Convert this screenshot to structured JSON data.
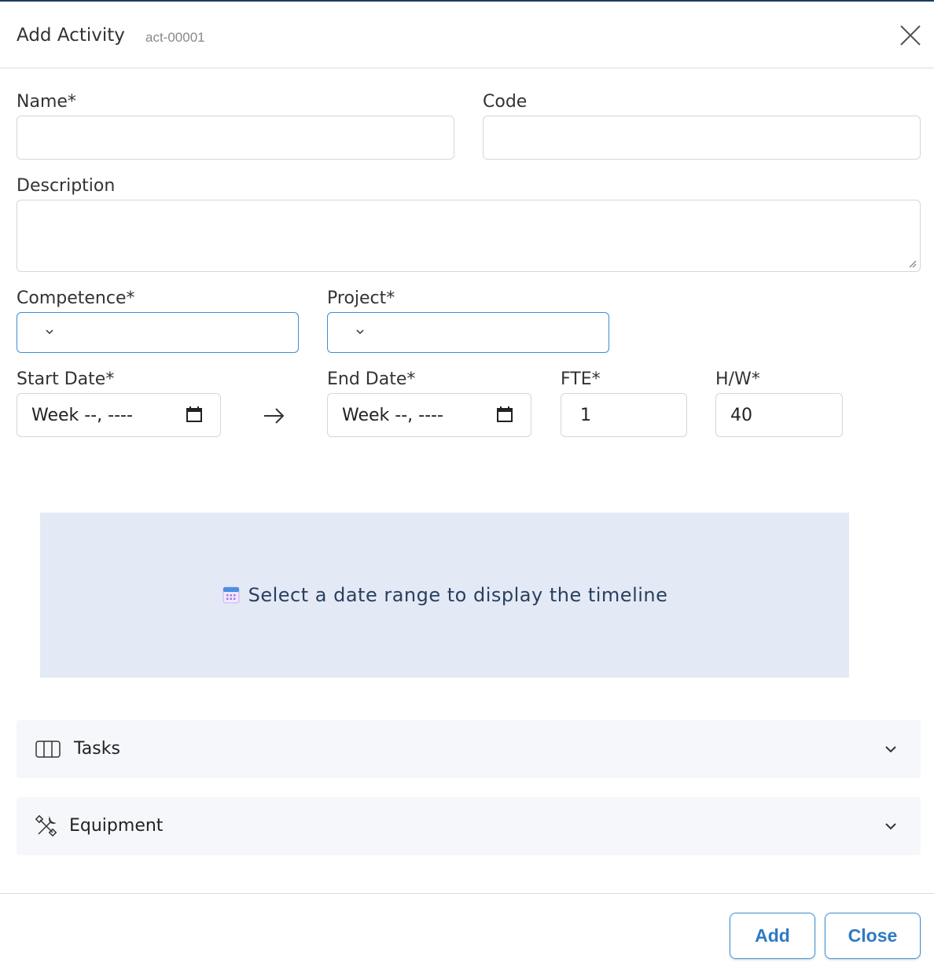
{
  "dialog": {
    "title": "Add Activity",
    "subtitle": "act-00001"
  },
  "form": {
    "name_label": "Name*",
    "name_value": "",
    "code_label": "Code",
    "code_value": "",
    "description_label": "Description",
    "description_value": "",
    "competence_label": "Competence*",
    "project_label": "Project*",
    "start_date_label": "Start Date*",
    "start_date_value": "Week --, ----",
    "end_date_label": "End Date*",
    "end_date_value": "Week --, ----",
    "fte_label": "FTE*",
    "fte_value": "1",
    "hw_label": "H/W*",
    "hw_value": "40"
  },
  "timeline": {
    "placeholder": "Select a date range to display the timeline"
  },
  "sections": {
    "tasks_label": "Tasks",
    "equipment_label": "Equipment"
  },
  "footer": {
    "add_label": "Add",
    "close_label": "Close"
  },
  "colors": {
    "accent": "#3a8fd6",
    "timeline_bg": "#e3eaf5",
    "section_bg": "#f5f7fa"
  },
  "icons": {
    "close": "close-icon",
    "calendar": "calendar-icon",
    "arrow": "arrow-right-icon",
    "tasks": "columns-icon",
    "equipment": "tools-icon",
    "chevron": "chevron-down-icon"
  }
}
